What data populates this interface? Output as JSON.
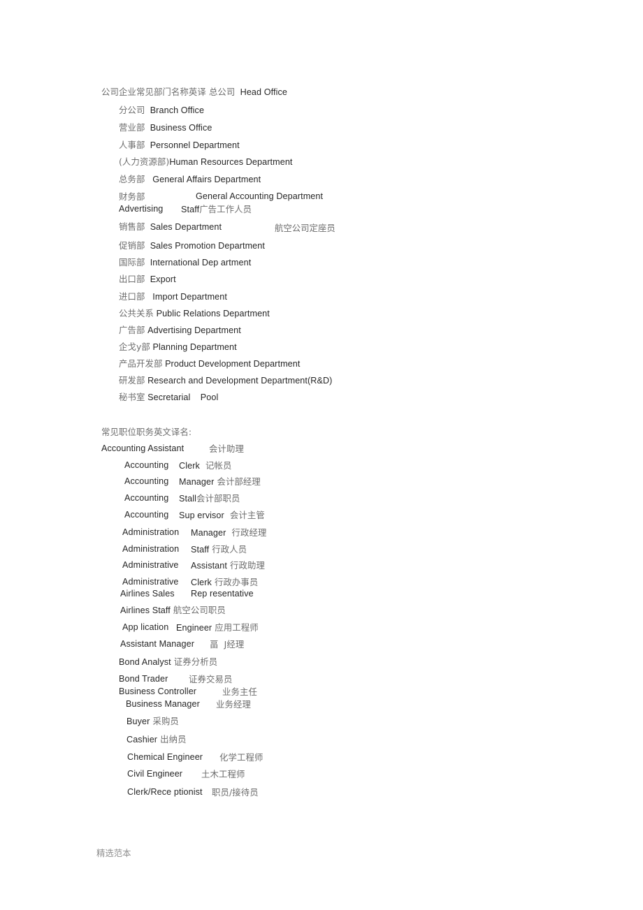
{
  "document": {
    "section_departments": {
      "heading_cn": "公司企业常见部门名称英译",
      "heading_term_cn": "总公司",
      "heading_term_en": "Head Office",
      "rows": [
        {
          "cn": "分公司",
          "en": "Branch Office"
        },
        {
          "cn": "营业部",
          "en": "Business Office"
        },
        {
          "cn": "人事部",
          "en": "Personnel Department"
        },
        {
          "cn": "(人力资源部)",
          "en": "Human Resources Department"
        },
        {
          "cn": "总务部",
          "en": "General Affairs Department"
        },
        {
          "cn": "财务部",
          "en": "General Accounting Department"
        },
        {
          "en": "Advertising",
          "en2": "Staff",
          "cn": "广告工作人员"
        },
        {
          "cn": "销售部",
          "en": "Sales Department"
        },
        {
          "cn": "促销部",
          "en": "Sales Promotion Department"
        },
        {
          "cn": "国际部",
          "en": "International Dep artment"
        },
        {
          "cn": "出口部",
          "en": "Export"
        },
        {
          "cn": "进口部",
          "en": "Import Department"
        },
        {
          "cn": "公共关系",
          "en": "Public Relations Department"
        },
        {
          "cn": "广告部",
          "en": "Advertising Department"
        },
        {
          "cn": "企戈y部",
          "en": "Planning Department"
        },
        {
          "cn": "产品开发部",
          "en": "Product Development Department"
        },
        {
          "cn": "研发部",
          "en": "Research and Development Department(R&D)"
        },
        {
          "cn": "秘书室",
          "en": "Secretarial",
          "en2": "Pool"
        }
      ],
      "floating_note_cn": "航空公司定座员"
    },
    "section_titles": {
      "heading_cn": "常见职位职务英文译名:",
      "rows": [
        {
          "en": "Accounting Assistant",
          "cn": "会计助理"
        },
        {
          "en": "Accounting",
          "en2": "Clerk",
          "cn": "记帐员"
        },
        {
          "en": "Accounting",
          "en2": "Manager",
          "cn": "会计部经理"
        },
        {
          "en": "Accounting",
          "en2": "Stall",
          "cn": "会计部职员"
        },
        {
          "en": "Accounting",
          "en2": "Sup ervisor",
          "cn": "会计主管"
        },
        {
          "en": "Administration",
          "en2": "Manager",
          "cn": "行政经理"
        },
        {
          "en": "Administration",
          "en2": "Staff",
          "cn": "行政人员"
        },
        {
          "en": "Administrative",
          "en2": "Assistant",
          "cn": "行政助理"
        },
        {
          "en": "Administrative",
          "en2": "Clerk",
          "cn": "行政办事员"
        },
        {
          "en": "Airlines Sales",
          "en2": "Rep resentative",
          "cn": ""
        },
        {
          "en": "Airlines Staff",
          "cn": "航空公司职员"
        },
        {
          "en": "App lication",
          "en2": "Engineer",
          "cn": "应用工程师"
        },
        {
          "en": "Assistant Manager",
          "cn": "畐  J经理"
        },
        {
          "en": "Bond Analyst",
          "cn": "证券分析员"
        },
        {
          "en": "Bond Trader",
          "cn": "证券交易员"
        },
        {
          "en": "Business Controller",
          "cn": "业务主任"
        },
        {
          "en": "Business Manager",
          "cn": "业务经理"
        },
        {
          "en": "Buyer",
          "cn": "采购员"
        },
        {
          "en": "Cashier",
          "cn": "出纳员"
        },
        {
          "en": "Chemical Engineer",
          "cn": "化学工程师"
        },
        {
          "en": "Civil Engineer",
          "cn": "土木工程师"
        },
        {
          "en": "Clerk/Rece ptionist",
          "cn": "职员/接待员"
        }
      ]
    },
    "footer": {
      "text": "精选范本"
    },
    "colors": {
      "latin_text": "#262626",
      "cjk_text": "#6d6d6d",
      "footer_text": "#8e8e8e",
      "background": "#ffffff"
    }
  }
}
